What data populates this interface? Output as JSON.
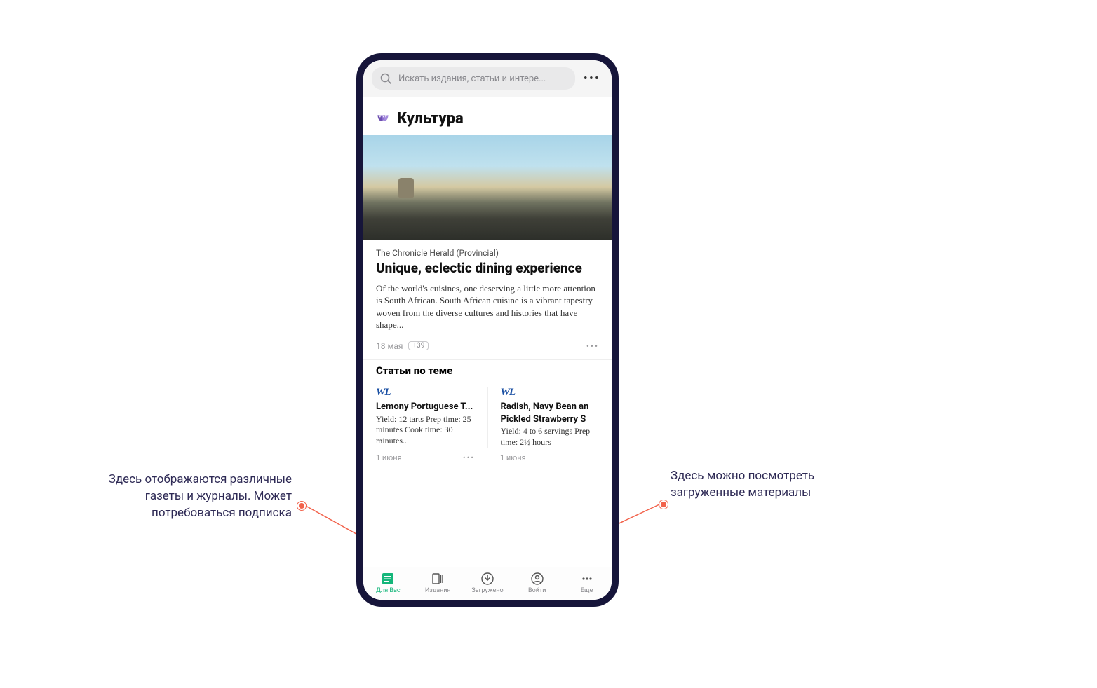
{
  "search": {
    "placeholder": "Искать издания, статьи и интере..."
  },
  "section": {
    "title": "Культура"
  },
  "article": {
    "source": "The Chronicle Herald (Provincial)",
    "headline": "Unique, eclectic dining experience",
    "body": "Of the world's cuisines, one deserving a little more attention is South African. South African cuisine is a vibrant tapestry woven from the diverse cultures and histories that have shape...",
    "date": "18 мая",
    "count": "+39"
  },
  "related": {
    "title": "Статьи по теме",
    "items": [
      {
        "logo": "WL",
        "title": "Lemony Portuguese T...",
        "body": "Yield: 12 tarts Prep time: 25 minutes Cook time: 30 minutes...",
        "date": "1 июня"
      },
      {
        "logo": "WL",
        "title": "Radish, Navy Bean an",
        "title2": "Pickled Strawberry S",
        "body": "Yield: 4 to 6 servings Prep time: 2½ hours",
        "date": "1 июня"
      }
    ]
  },
  "nav": {
    "items": [
      {
        "label": "Для Вас"
      },
      {
        "label": "Издания"
      },
      {
        "label": "Загружено"
      },
      {
        "label": "Войти"
      },
      {
        "label": "Еще"
      }
    ]
  },
  "annotations": {
    "left": "Здесь отображаются различные газеты и журналы. Может потребоваться подписка",
    "right": "Здесь можно посмотреть загруженные материалы"
  }
}
